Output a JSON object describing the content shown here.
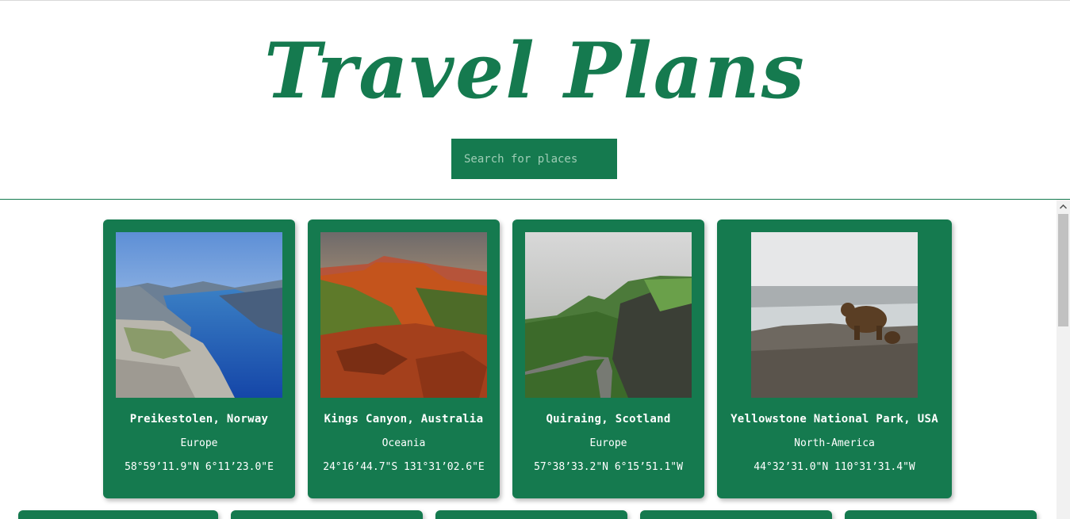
{
  "header": {
    "title": "Travel Plans",
    "search_placeholder": "Search for places"
  },
  "places": [
    {
      "name": "Preikestolen, Norway",
      "continent": "Europe",
      "coords": "58°59’11.9\"N 6°11’23.0\"E",
      "photo_icon": "fjord-cliff-photo"
    },
    {
      "name": "Kings Canyon, Australia",
      "continent": "Oceania",
      "coords": "24°16’44.7\"S 131°31’02.6\"E",
      "photo_icon": "red-canyon-photo"
    },
    {
      "name": "Quiraing, Scotland",
      "continent": "Europe",
      "coords": "57°38’33.2\"N 6°15’51.1\"W",
      "photo_icon": "green-highland-road-photo"
    },
    {
      "name": "Yellowstone National Park, USA",
      "continent": "North-America",
      "coords": "44°32’31.0\"N 110°31’31.4\"W",
      "photo_icon": "grizzly-bear-photo"
    }
  ],
  "colors": {
    "accent": "#157a4f",
    "card_text": "#ffffff",
    "background": "#ffffff"
  }
}
